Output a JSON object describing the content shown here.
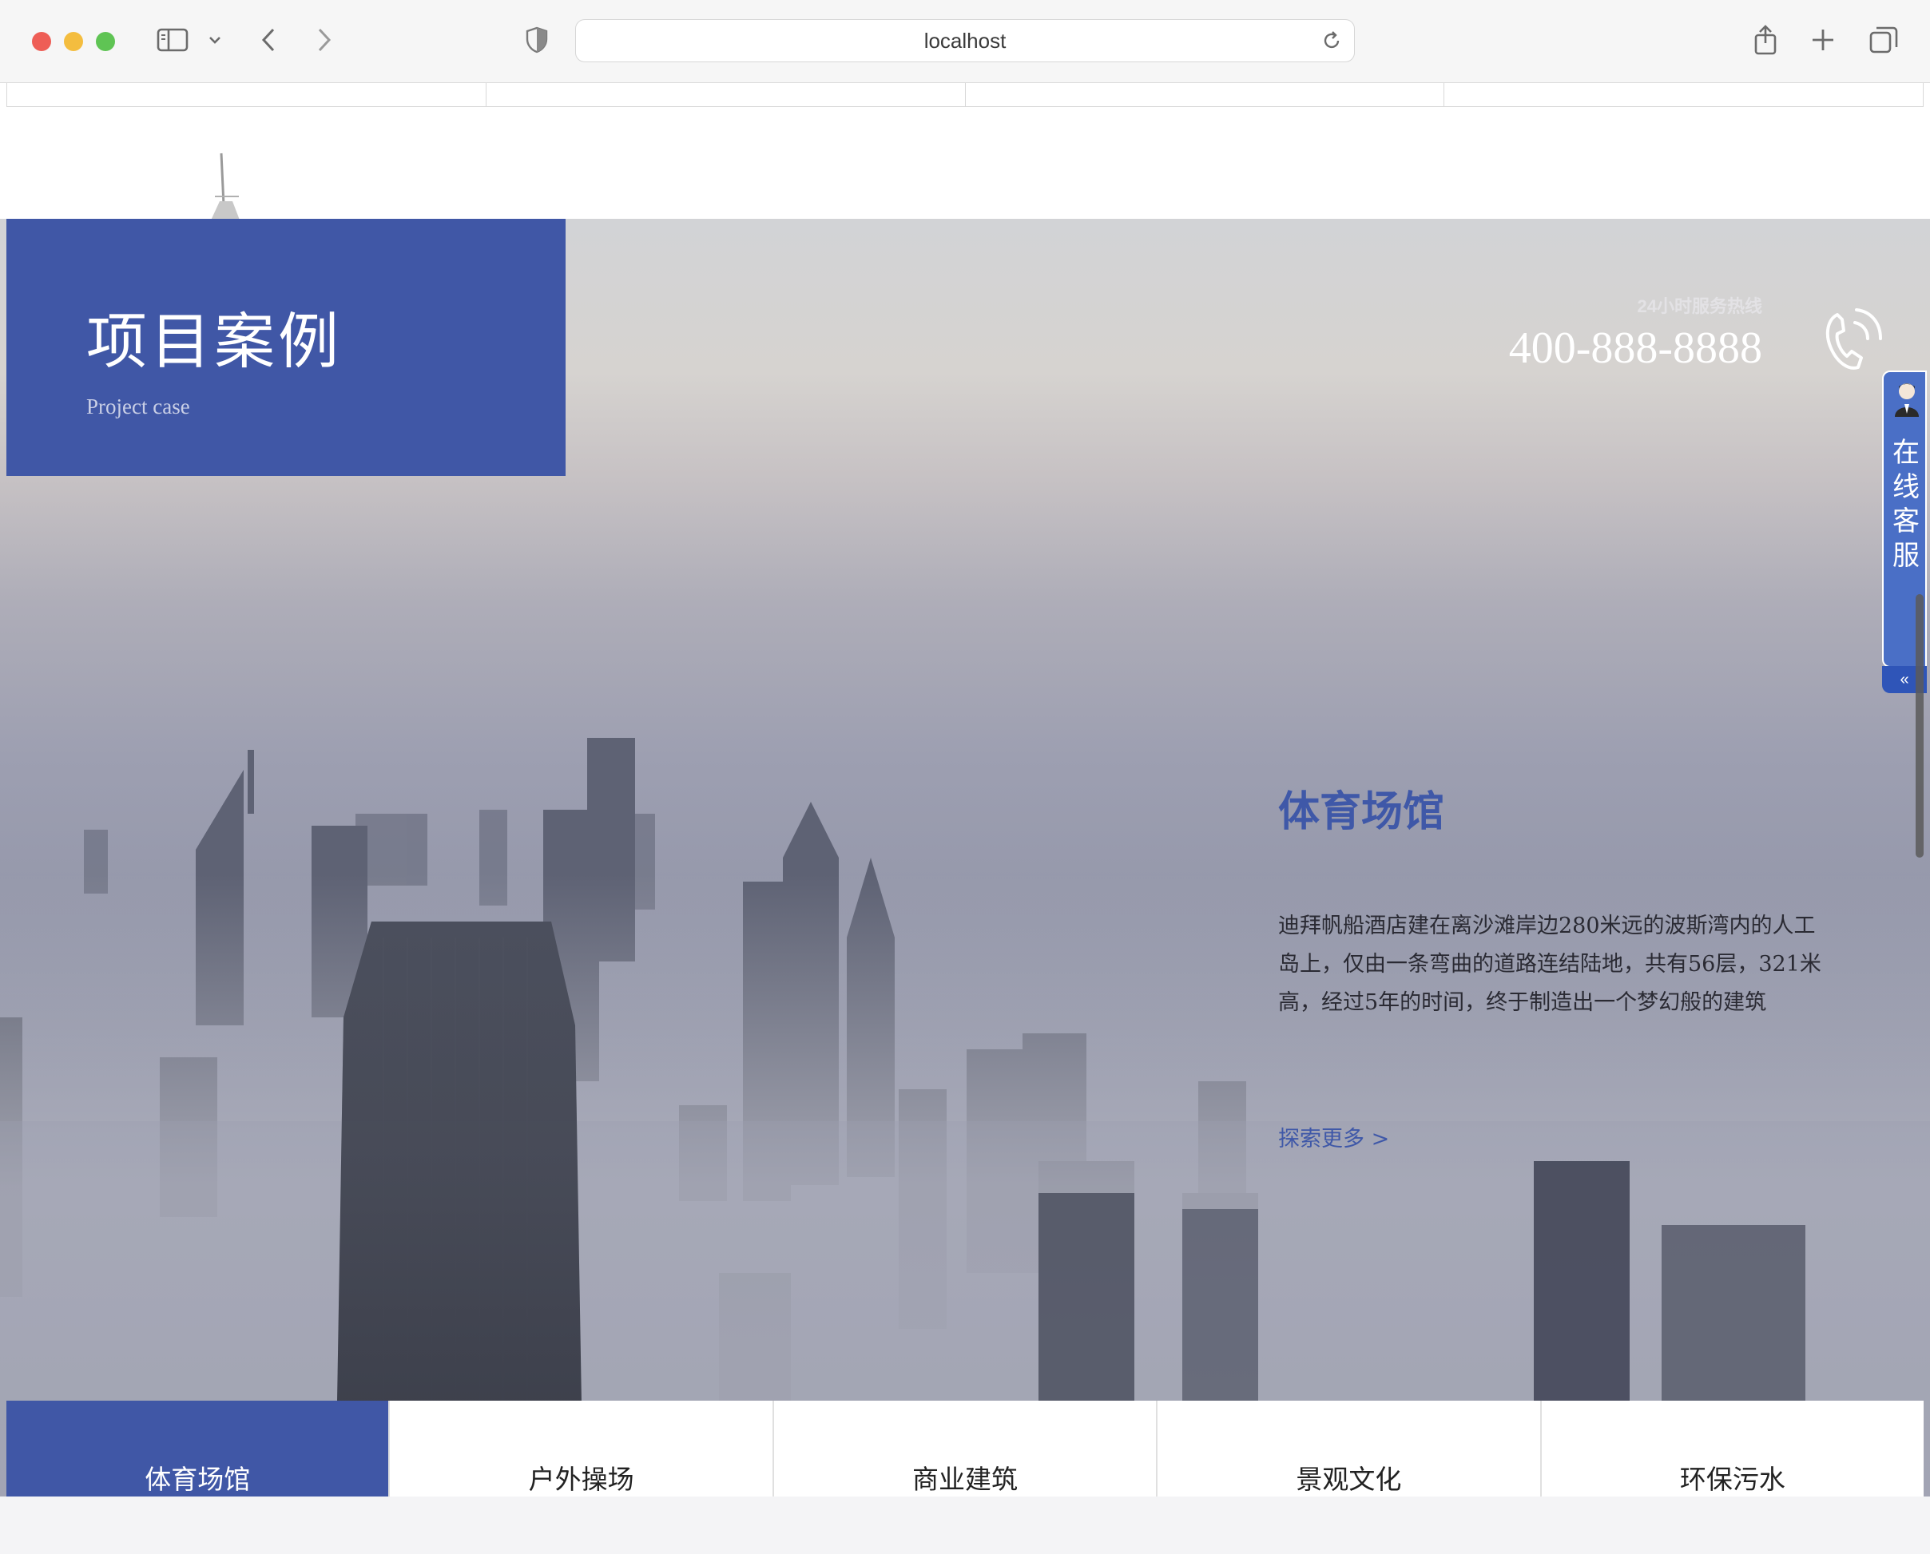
{
  "browser": {
    "url": "localhost"
  },
  "hero": {
    "title_cn": "项目案例",
    "title_en": "Project case",
    "hotline_label": "24小时服务热线",
    "hotline_number": "400-888-8888"
  },
  "service": {
    "label": "在线客服",
    "collapse": "«"
  },
  "case": {
    "title": "体育场馆",
    "description": "迪拜帆船酒店建在离沙滩岸边280米远的波斯湾内的人工岛上，仅由一条弯曲的道路连结陆地，共有56层，321米高，经过5年的时间，终于制造出一个梦幻般的建筑",
    "more": "探索更多 >"
  },
  "tabs": [
    {
      "label": "体育场馆",
      "active": true
    },
    {
      "label": "户外操场",
      "active": false
    },
    {
      "label": "商业建筑",
      "active": false
    },
    {
      "label": "景观文化",
      "active": false
    },
    {
      "label": "环保污水",
      "active": false
    }
  ],
  "colors": {
    "brand_blue": "#4057a6",
    "service_blue": "#4a6fc6"
  }
}
